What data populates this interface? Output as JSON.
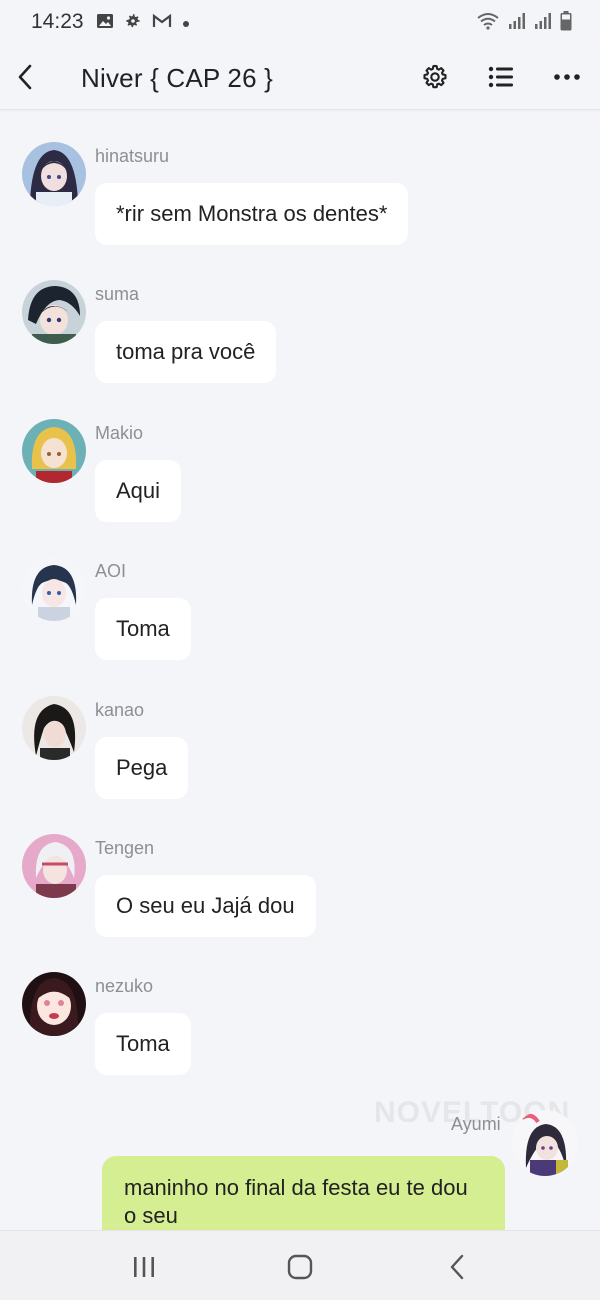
{
  "status_bar": {
    "time": "14:23",
    "left_icons": [
      "image-icon",
      "settings-icon",
      "gmail-icon",
      "dot-icon"
    ],
    "right_icons": [
      "wifi-icon",
      "signal-icon",
      "signal-icon",
      "battery-icon"
    ]
  },
  "header": {
    "title": "Niver { CAP 26 }"
  },
  "messages": [
    {
      "sender": "hinatsuru",
      "text": "*rir sem Monstra os dentes*"
    },
    {
      "sender": "suma",
      "text": "toma pra você"
    },
    {
      "sender": "Makio",
      "text": "Aqui"
    },
    {
      "sender": "AOI",
      "text": "Toma"
    },
    {
      "sender": "kanao",
      "text": "Pega"
    },
    {
      "sender": "Tengen",
      "text": "O seu eu Jajá dou"
    },
    {
      "sender": "nezuko",
      "text": "Toma"
    }
  ],
  "outgoing": {
    "sender": "Ayumi",
    "text": "maninho no final da festa eu te dou o seu",
    "watermark": "NOVELTOON"
  },
  "colors": {
    "background": "#f4f5f9",
    "incoming_bubble": "#ffffff",
    "outgoing_bubble": "#d5ee92"
  }
}
